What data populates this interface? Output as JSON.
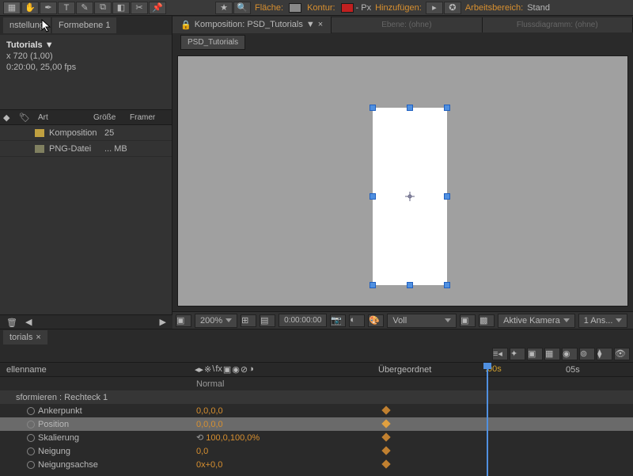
{
  "toolbar": {
    "fill_label": "Fläche:",
    "stroke_label": "Kontur:",
    "stroke_px": "- Px",
    "add_label": "Hinzufügen:",
    "workspace_label": "Arbeitsbereich:",
    "workspace_value": "Stand"
  },
  "project": {
    "tabs": [
      "nstellung",
      "Formebene 1"
    ],
    "title": "Tutorials ▼",
    "res": "x 720 (1,00)",
    "dur": "0:20:00, 25,00 fps",
    "cols": {
      "art": "Art",
      "size": "Größe",
      "fr": "Framer"
    },
    "rows": [
      {
        "type": "Komposition",
        "size": "25"
      },
      {
        "type": "PNG-Datei",
        "size": "... MB"
      }
    ]
  },
  "viewer": {
    "tabs": [
      {
        "label": "Komposition: PSD_Tutorials",
        "dd": "▼"
      },
      {
        "label": "Ebene: (ohne)"
      },
      {
        "label": "Flussdiagramm: (ohne)"
      }
    ],
    "comp_tab": "PSD_Tutorials",
    "footer": {
      "zoom": "200%",
      "time": "0:00:00:00",
      "res": "Voll",
      "camera": "Aktive Kamera",
      "view": "1 Ans..."
    }
  },
  "timeline": {
    "tab": "torials",
    "ruler": {
      "cti": ":00s",
      "t5": "05s"
    },
    "header": {
      "name": "ellenname",
      "parent": "Übergeordnet"
    },
    "icons_row": "Normal",
    "section": "sformieren : Rechteck 1",
    "props": [
      {
        "name": "Ankerpunkt",
        "val": "0,0,0,0"
      },
      {
        "name": "Position",
        "val": "0,0,0,0",
        "sel": true,
        "kf": true
      },
      {
        "name": "Skalierung",
        "val": "100,0,100,0%",
        "link": "⟲"
      },
      {
        "name": "Neigung",
        "val": "0,0"
      },
      {
        "name": "Neigungsachse",
        "val": "0x+0,0"
      }
    ]
  }
}
